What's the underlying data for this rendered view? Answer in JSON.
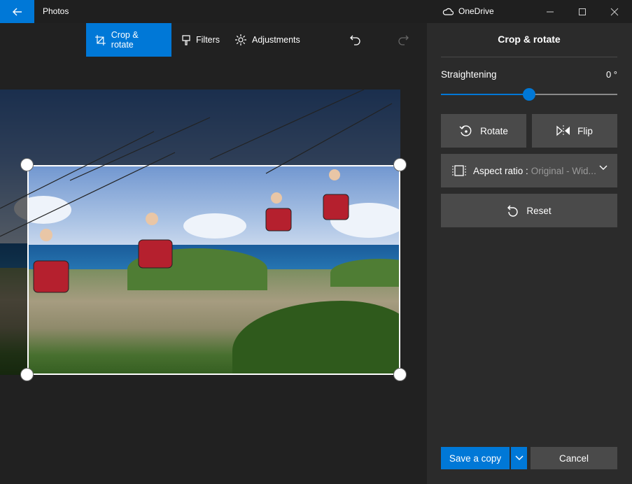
{
  "window": {
    "app_title": "Photos",
    "onedrive_label": "OneDrive",
    "icons": [
      "back-arrow-icon",
      "cloud-icon",
      "minimize-icon",
      "maximize-icon",
      "close-icon"
    ]
  },
  "toolbar": {
    "crop_rotate_label": "Crop & rotate",
    "filters_label": "Filters",
    "adjustments_label": "Adjustments"
  },
  "panel": {
    "title": "Crop & rotate",
    "straightening_label": "Straightening",
    "straightening_value": "0 °",
    "straightening_level": 0.5,
    "rotate_label": "Rotate",
    "flip_label": "Flip",
    "aspect_label": "Aspect ratio :",
    "aspect_value": "Original - Wid...",
    "reset_label": "Reset",
    "save_label": "Save a copy",
    "cancel_label": "Cancel"
  },
  "colors": {
    "accent": "#0078d7",
    "panel_bg": "#2b2b2b",
    "button_bg": "#4a4a4a"
  }
}
